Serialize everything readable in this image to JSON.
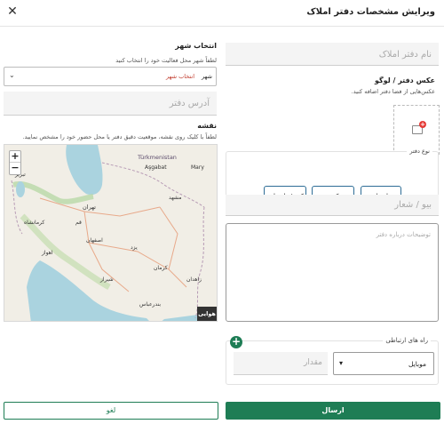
{
  "header": {
    "title": "ویرایش مشخصات دفتر املاک",
    "close_icon": "close-icon"
  },
  "office_name": {
    "placeholder": "نام دفتر املاک"
  },
  "logo": {
    "title": "عکس دفتر / لوگو",
    "hint": "عکس‌هایی از فضا دفتر اضافه کنید.",
    "icon": "add-image-icon"
  },
  "office_type": {
    "label": "نوع دفتر",
    "options": [
      "دیارتمانی",
      "کفی",
      "کفی/دیارتمانی"
    ]
  },
  "bio": {
    "placeholder": "بیو / شعار"
  },
  "description": {
    "placeholder": "توضیحات درباره دفتر"
  },
  "contact": {
    "label": "راه های ارتباطی",
    "type_value": "موبایل",
    "amount_placeholder": "مقدار",
    "add_icon": "plus-icon"
  },
  "city": {
    "title": "انتخاب شهر",
    "hint": "لطفاً شهر محل فعالیت خود را انتخاب کنید",
    "field_label": "شهر",
    "value": "انتخاب شهر"
  },
  "address": {
    "placeholder": "آدرس دفتر"
  },
  "map": {
    "title": "نقشه",
    "hint": "لطفاً با کلیک روی نقشه، موقعیت دقیق دفتر یا محل حضور خود را مشخص نمایید.",
    "zoom_in": "+",
    "zoom_out": "−",
    "satellite_label": "هوایی",
    "labels": [
      "Türkmenistan",
      "Aşgabat",
      "Mary",
      "تهران",
      "اصفهان",
      "شیراز",
      "مشهد",
      "یزد",
      "کرمان",
      "زاهدان",
      "بندرعباس",
      "تبریز",
      "اهواز",
      "قم",
      "کرمانشاه"
    ]
  },
  "actions": {
    "send": "ارسال",
    "cancel": "لغو"
  },
  "colors": {
    "primary": "#1e7d55",
    "accent_red": "#e53935",
    "chip_border": "#2e6d96"
  }
}
